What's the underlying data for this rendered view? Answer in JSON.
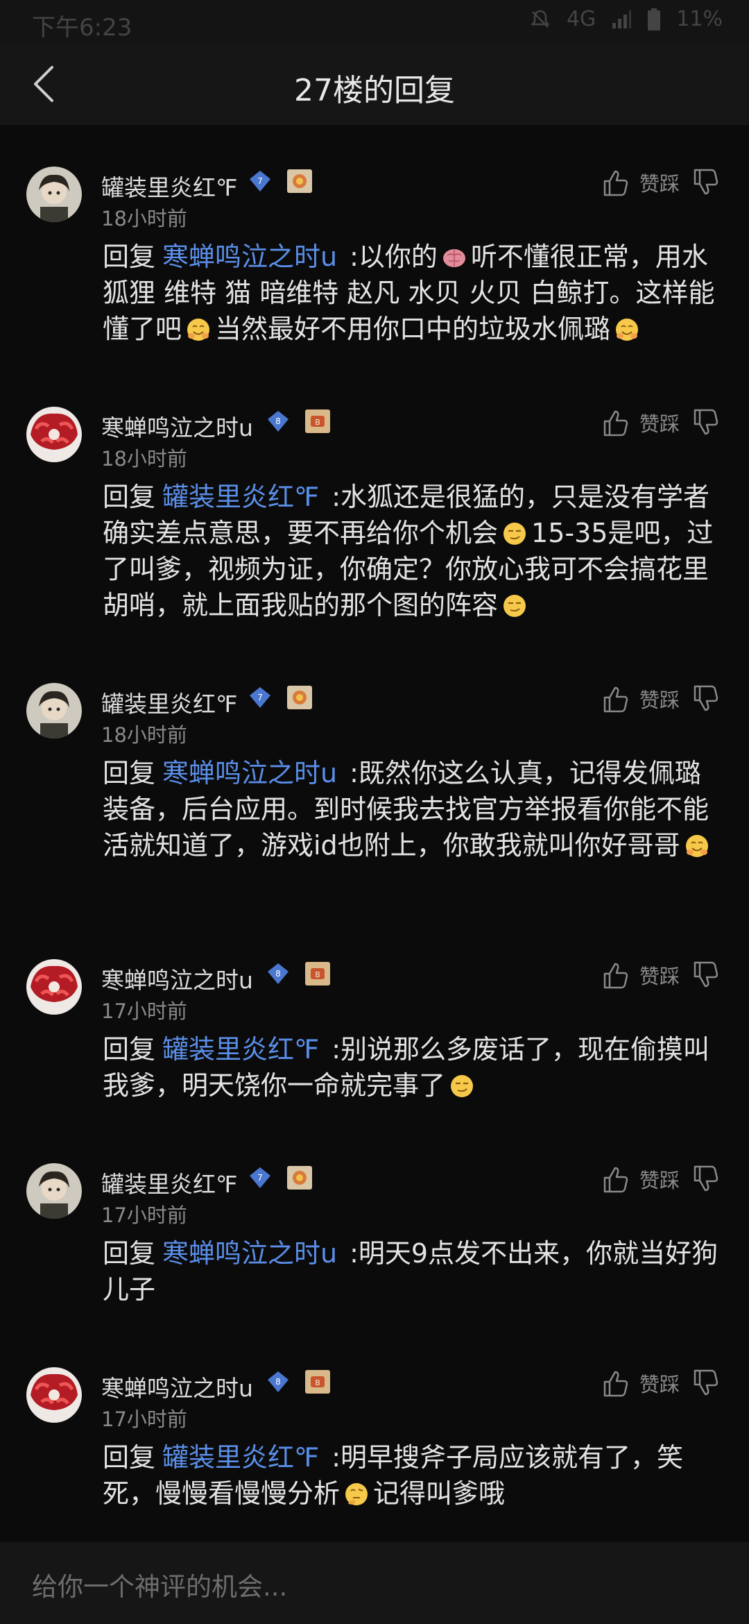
{
  "status_bar": {
    "time": "下午6:23",
    "network": "4G",
    "battery": "11%"
  },
  "nav": {
    "title": "27楼的回复"
  },
  "action_labels": {
    "like_dislike": "赞踩"
  },
  "comments": [
    {
      "user": "罐装里炎红℉",
      "gem_level": "7",
      "time": "18小时前",
      "reply_prefix": "回复",
      "mention": "寒蝉鸣泣之时u",
      "parts": [
        ":以你的",
        "听不懂很正常，用水狐狸 维特 猫 暗维特 赵凡 水贝 火贝 白鲸打。这样能懂了吧",
        "当然最好不用你口中的垃圾水佩璐"
      ]
    },
    {
      "user": "寒蝉鸣泣之时u",
      "gem_level": "8",
      "time": "18小时前",
      "reply_prefix": "回复",
      "mention": "罐装里炎红℉",
      "parts": [
        ":水狐还是很猛的，只是没有学者确实差点意思，要不再给你个机会",
        "15-35是吧，过了叫爹，视频为证，你确定？你放心我可不会搞花里胡哨，就上面我贴的那个图的阵容"
      ]
    },
    {
      "user": "罐装里炎红℉",
      "gem_level": "7",
      "time": "18小时前",
      "reply_prefix": "回复",
      "mention": "寒蝉鸣泣之时u",
      "parts": [
        ":既然你这么认真，记得发佩璐装备，后台应用。到时候我去找官方举报看你能不能活就知道了，游戏id也附上，你敢我就叫你好哥哥"
      ]
    },
    {
      "user": "寒蝉鸣泣之时u",
      "gem_level": "8",
      "time": "17小时前",
      "reply_prefix": "回复",
      "mention": "罐装里炎红℉",
      "parts": [
        ":别说那么多废话了，现在偷摸叫我爹，明天饶你一命就完事了"
      ]
    },
    {
      "user": "罐装里炎红℉",
      "gem_level": "7",
      "time": "17小时前",
      "reply_prefix": "回复",
      "mention": "寒蝉鸣泣之时u",
      "parts": [
        ":明天9点发不出来，你就当好狗儿子"
      ]
    },
    {
      "user": "寒蝉鸣泣之时u",
      "gem_level": "8",
      "time": "17小时前",
      "reply_prefix": "回复",
      "mention": "罐装里炎红℉",
      "parts": [
        ":明早搜斧子局应该就有了，笑死，慢慢看慢慢分析",
        "记得叫爹哦"
      ]
    }
  ],
  "composer": {
    "placeholder": "给你一个神评的机会..."
  },
  "colors": {
    "background": "#0b0b0b",
    "mention": "#5a8ee8",
    "gem": "#4a78d0"
  }
}
